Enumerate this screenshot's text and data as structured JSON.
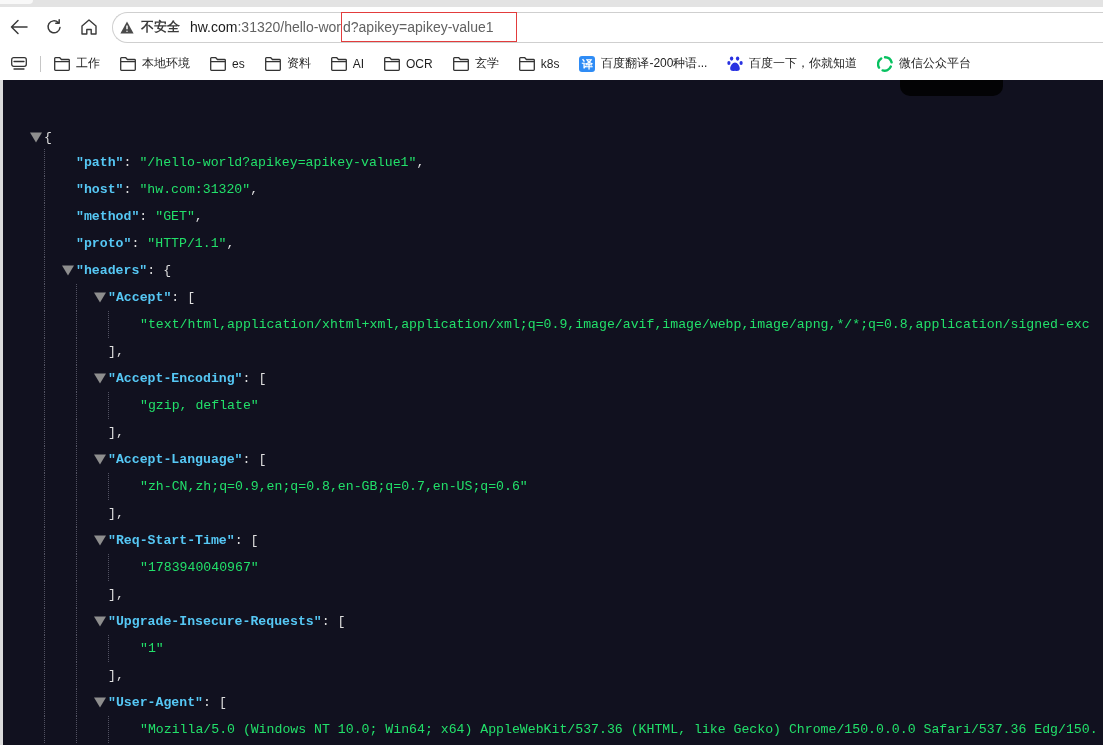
{
  "address_bar": {
    "security_label": "不安全",
    "url_parts": [
      {
        "text": "hw.com",
        "kind": "host",
        "highlighted": false
      },
      {
        "text": ":31320/hello-wor",
        "kind": "path",
        "highlighted": false
      },
      {
        "text": "d?apikey=apikey-value1",
        "kind": "path",
        "highlighted": true
      }
    ]
  },
  "bookmarks": [
    {
      "label": "工作",
      "kind": "folder"
    },
    {
      "label": "本地环境",
      "kind": "folder"
    },
    {
      "label": "es",
      "kind": "folder"
    },
    {
      "label": "资料",
      "kind": "folder"
    },
    {
      "label": "AI",
      "kind": "folder"
    },
    {
      "label": "OCR",
      "kind": "folder"
    },
    {
      "label": "玄学",
      "kind": "folder"
    },
    {
      "label": "k8s",
      "kind": "folder"
    },
    {
      "label": "百度翻译-200种语...",
      "kind": "translate",
      "glyph": "译"
    },
    {
      "label": "百度一下，你就知道",
      "kind": "paw"
    },
    {
      "label": "微信公众平台",
      "kind": "rings"
    }
  ],
  "json_viewer": {
    "root": {
      "kind": "object",
      "open": "{",
      "expanded": true,
      "children": [
        {
          "kind": "string",
          "key": "\"path\"",
          "colon": ":",
          "value": "\"/hello-world?apikey=apikey-value1\"",
          "comma": ","
        },
        {
          "kind": "string",
          "key": "\"host\"",
          "colon": ":",
          "value": "\"hw.com:31320\"",
          "comma": ","
        },
        {
          "kind": "string",
          "key": "\"method\"",
          "colon": ":",
          "value": "\"GET\"",
          "comma": ","
        },
        {
          "kind": "string",
          "key": "\"proto\"",
          "colon": ":",
          "value": "\"HTTP/1.1\"",
          "comma": ","
        },
        {
          "kind": "object",
          "key": "\"headers\"",
          "colon": ":",
          "open": "{",
          "expanded": true,
          "children": [
            {
              "kind": "array",
              "key": "\"Accept\"",
              "colon": ":",
              "open": "[",
              "expanded": true,
              "close": "],",
              "children": [
                {
                  "kind": "string",
                  "value": "\"text/html,application/xhtml+xml,application/xml;q=0.9,image/avif,image/webp,image/apng,*/*;q=0.8,application/signed-exc"
                }
              ]
            },
            {
              "kind": "array",
              "key": "\"Accept-Encoding\"",
              "colon": ":",
              "open": "[",
              "expanded": true,
              "close": "],",
              "children": [
                {
                  "kind": "string",
                  "value": "\"gzip, deflate\""
                }
              ]
            },
            {
              "kind": "array",
              "key": "\"Accept-Language\"",
              "colon": ":",
              "open": "[",
              "expanded": true,
              "close": "],",
              "children": [
                {
                  "kind": "string",
                  "value": "\"zh-CN,zh;q=0.9,en;q=0.8,en-GB;q=0.7,en-US;q=0.6\""
                }
              ]
            },
            {
              "kind": "array",
              "key": "\"Req-Start-Time\"",
              "colon": ":",
              "open": "[",
              "expanded": true,
              "close": "],",
              "children": [
                {
                  "kind": "string",
                  "value": "\"1783940040967\""
                }
              ]
            },
            {
              "kind": "array",
              "key": "\"Upgrade-Insecure-Requests\"",
              "colon": ":",
              "open": "[",
              "expanded": true,
              "close": "],",
              "children": [
                {
                  "kind": "string",
                  "value": "\"1\""
                }
              ]
            },
            {
              "kind": "array",
              "key": "\"User-Agent\"",
              "colon": ":",
              "open": "[",
              "expanded": true,
              "children": [
                {
                  "kind": "string",
                  "value": "\"Mozilla/5.0 (Windows NT 10.0; Win64; x64) AppleWebKit/537.36 (KHTML, like Gecko) Chrome/150.0.0.0 Safari/537.36 Edg/150."
                }
              ]
            }
          ]
        }
      ]
    }
  }
}
